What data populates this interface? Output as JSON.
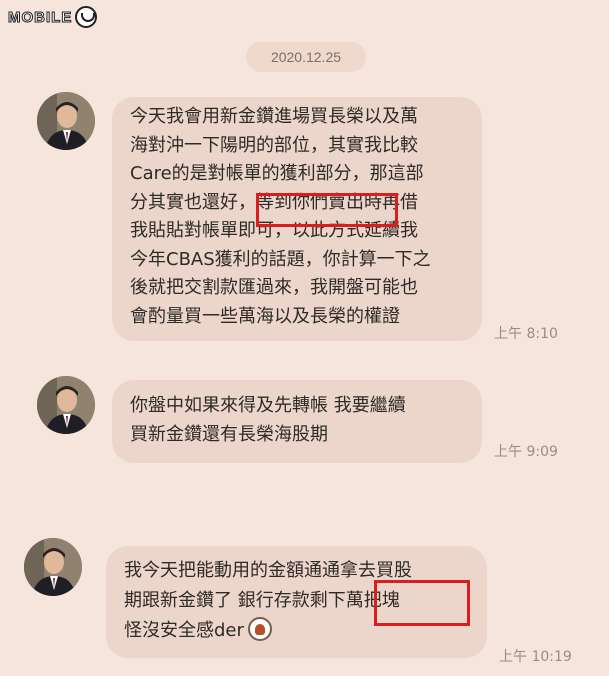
{
  "watermark": {
    "text": "MOBILE",
    "icon": "mobile01-logo-icon"
  },
  "date_separator": "2020.12.25",
  "messages": [
    {
      "lines": [
        "今天我會用新金鑽進場買長榮以及萬",
        "海對沖一下陽明的部位，其實我比較",
        "Care的是對帳單的獲利部分，那這部",
        "分其實也還好，等到你們賣出時再借",
        "我貼貼對帳單即可，以此方式延續我",
        "今年CBAS獲利的話題，你計算一下之",
        "後就把交割款匯過來，我開盤可能也",
        "會酌量買一些萬海以及長榮的權證"
      ],
      "time": "上午 8:10",
      "highlight": "等到你們賣出"
    },
    {
      "lines": [
        "你盤中如果來得及先轉帳  我要繼續",
        "買新金鑽還有長榮海股期"
      ],
      "time": "上午 9:09"
    },
    {
      "lines": [
        "我今天把能動用的金額通通拿去買股",
        "期跟新金鑽了  銀行存款剩下萬把塊",
        "怪沒安全感der"
      ],
      "time": "上午 10:19",
      "highlight": "萬把塊",
      "emoji": "dog-face-emoji-icon"
    }
  ],
  "colors": {
    "background": "#f6e5dc",
    "bubble": "#ecd6cc",
    "highlight_box": "#d81e1e"
  }
}
